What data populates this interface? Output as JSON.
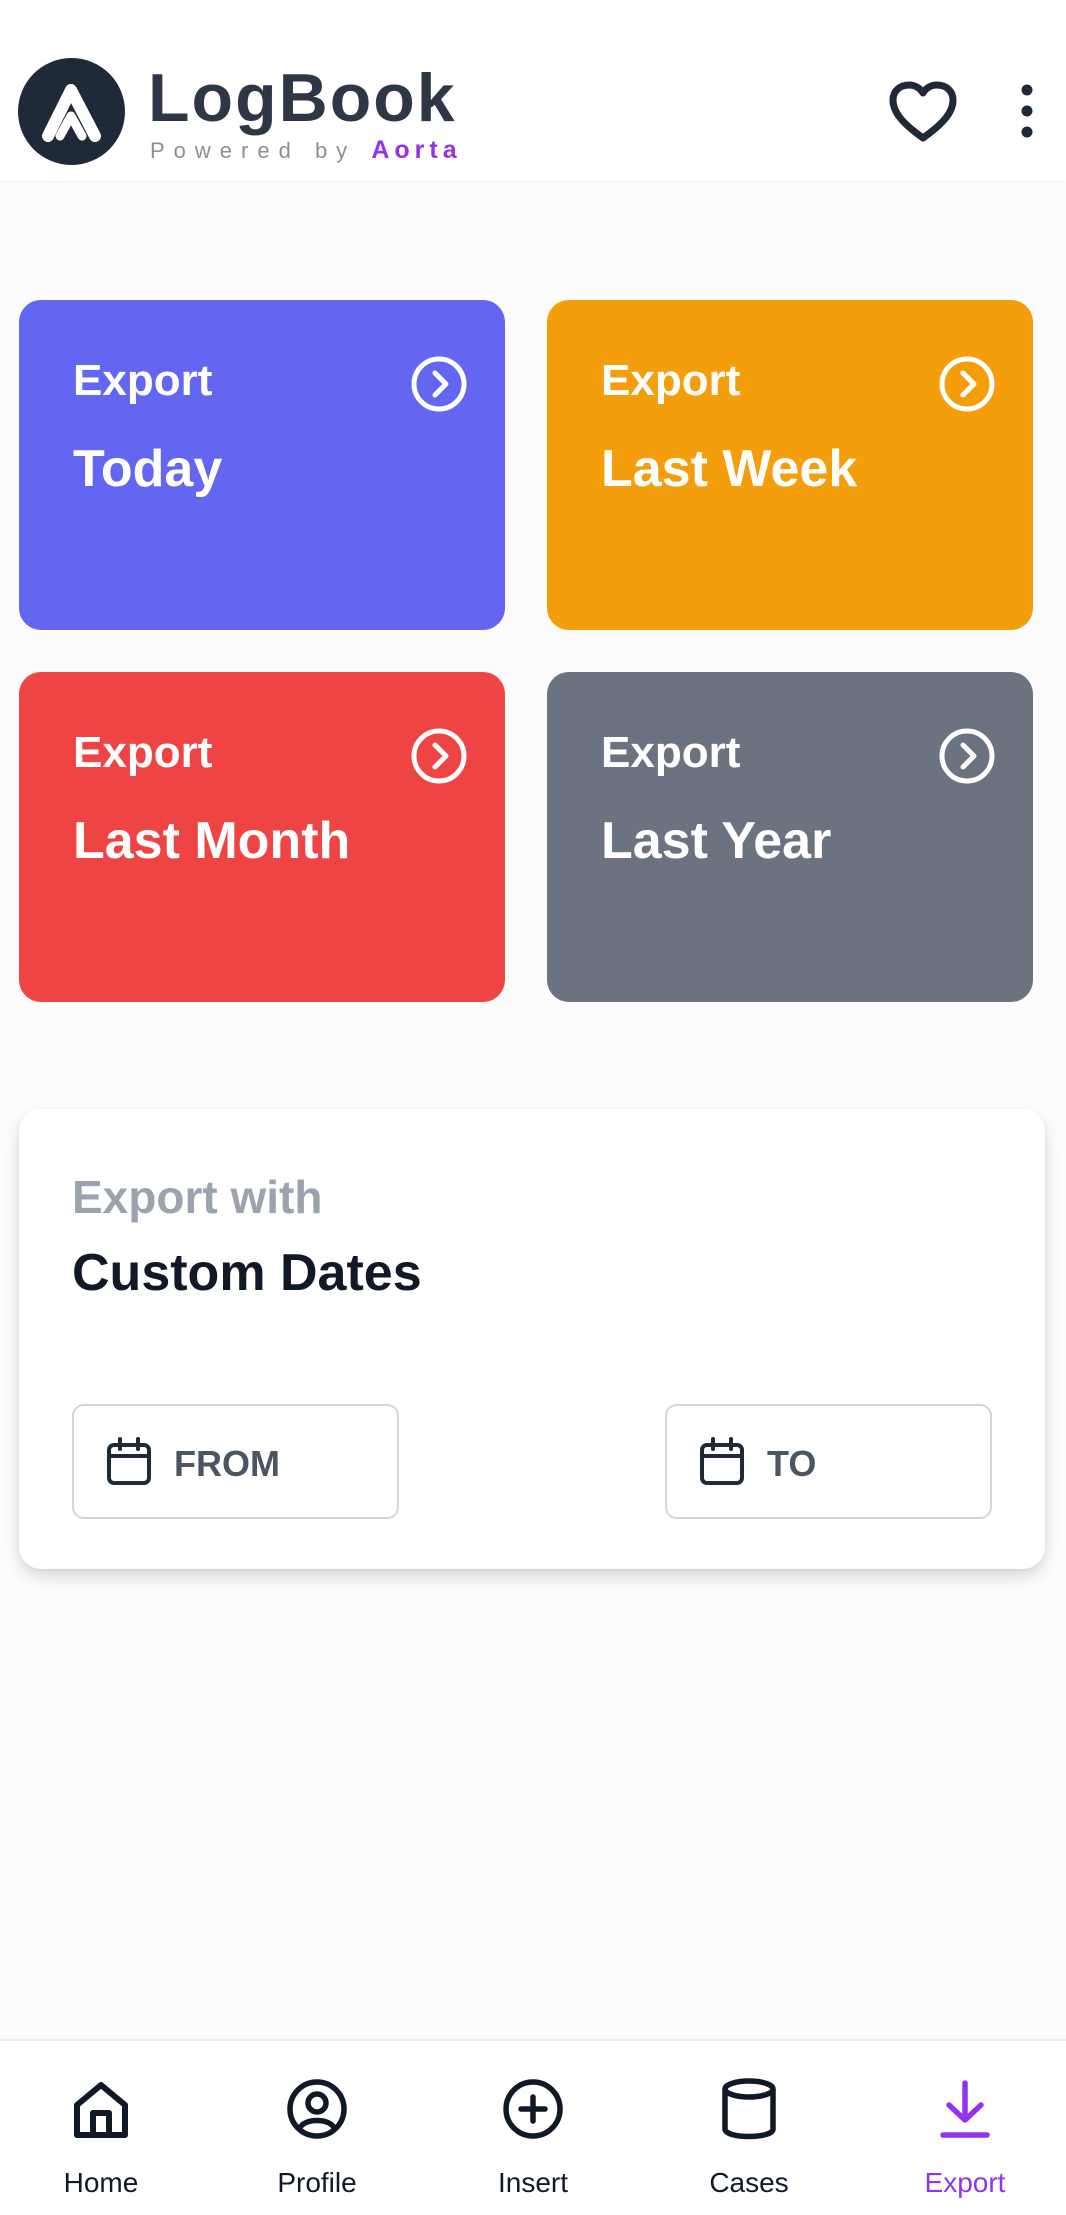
{
  "header": {
    "title": "LogBook",
    "powered_prefix": "Powered by",
    "powered_brand": "Aorta",
    "logo_icon": "aorta-logo-icon",
    "favorite_icon": "heart-icon",
    "menu_icon": "more-vertical-icon"
  },
  "tiles": [
    {
      "label": "Export",
      "value": "Today",
      "color": "#6366f1",
      "icon": "chevron-right-circle-icon"
    },
    {
      "label": "Export",
      "value": "Last Week",
      "color": "#f59e0b",
      "icon": "chevron-right-circle-icon"
    },
    {
      "label": "Export",
      "value": "Last Month",
      "color": "#ef4444",
      "icon": "chevron-right-circle-icon"
    },
    {
      "label": "Export",
      "value": "Last Year",
      "color": "#6b7280",
      "icon": "chevron-right-circle-icon"
    }
  ],
  "custom": {
    "label": "Export with",
    "title": "Custom Dates",
    "from_label": "FROM",
    "to_label": "TO",
    "date_icon": "calendar-icon"
  },
  "nav": {
    "items": [
      {
        "label": "Home",
        "icon": "home-icon"
      },
      {
        "label": "Profile",
        "icon": "user-circle-icon"
      },
      {
        "label": "Insert",
        "icon": "plus-circle-icon"
      },
      {
        "label": "Cases",
        "icon": "database-icon"
      },
      {
        "label": "Export",
        "icon": "download-icon"
      }
    ],
    "active": "Export",
    "active_color": "#9333ea"
  }
}
